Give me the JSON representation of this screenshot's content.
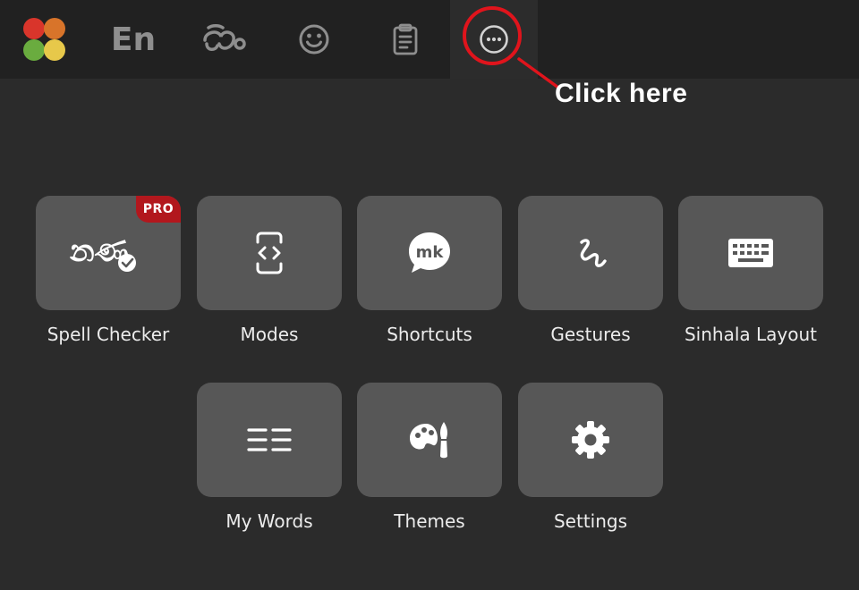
{
  "toolbar": {
    "english_label": "En",
    "colors": {
      "logo": [
        "#d9352b",
        "#d8742a",
        "#6aac3f",
        "#e7c84a"
      ],
      "highlight": "#e0141c"
    },
    "icons": [
      "app-logo-icon",
      "sinhala-letter-icon",
      "emoji-icon",
      "clipboard-icon",
      "more-options-icon"
    ]
  },
  "annotation": {
    "text": "Click here"
  },
  "grid": {
    "row1": [
      {
        "label": "Spell Checker",
        "icon": "spell-check-icon",
        "badge": "PRO"
      },
      {
        "label": "Modes",
        "icon": "modes-icon"
      },
      {
        "label": "Shortcuts",
        "icon": "shortcuts-icon",
        "icon_text": "mk"
      },
      {
        "label": "Gestures",
        "icon": "gesture-icon"
      },
      {
        "label": "Sinhala Layout",
        "icon": "keyboard-icon"
      }
    ],
    "row2": [
      {
        "label": "My Words",
        "icon": "list-icon"
      },
      {
        "label": "Themes",
        "icon": "palette-icon"
      },
      {
        "label": "Settings",
        "icon": "gear-icon"
      }
    ],
    "spell_icon_text": "නණ"
  }
}
